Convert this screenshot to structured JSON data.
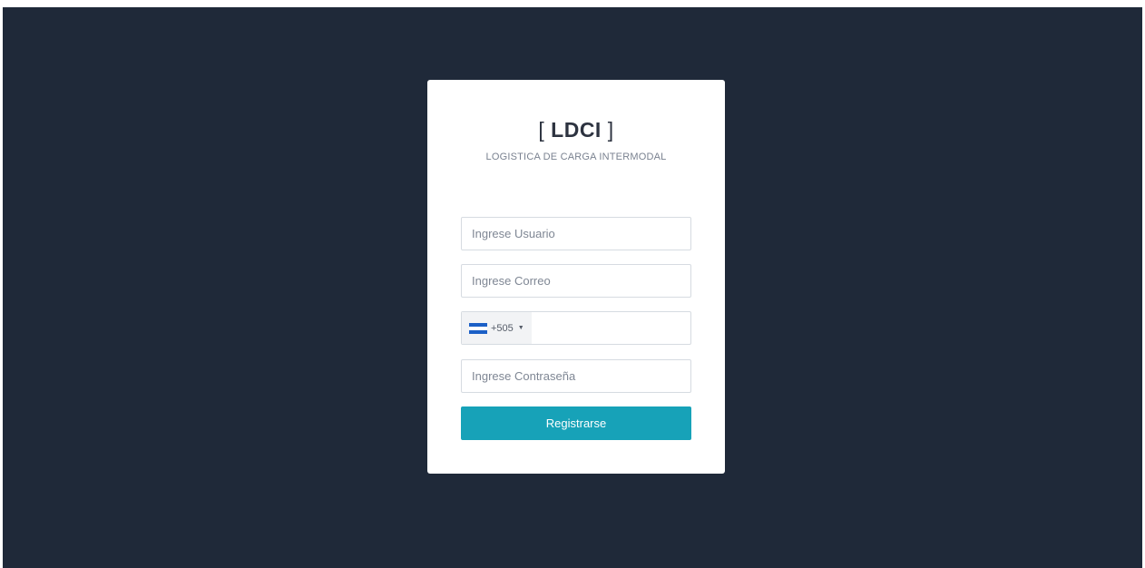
{
  "brand": {
    "open": "[ ",
    "name": "LDCI",
    "close": " ]",
    "subtitle": "LOGISTICA DE CARGA INTERMODAL"
  },
  "form": {
    "username": {
      "placeholder": "Ingrese Usuario",
      "value": ""
    },
    "email": {
      "placeholder": "Ingrese Correo",
      "value": ""
    },
    "phone": {
      "country_code": "+505",
      "flag": "nicaragua-flag-icon",
      "value": ""
    },
    "password": {
      "placeholder": "Ingrese Contraseña",
      "value": ""
    },
    "submit_label": "Registrarse"
  },
  "colors": {
    "background": "#1f2939",
    "card": "#ffffff",
    "primary_button": "#17a2b8",
    "flag_blue": "#1b5fc6"
  }
}
